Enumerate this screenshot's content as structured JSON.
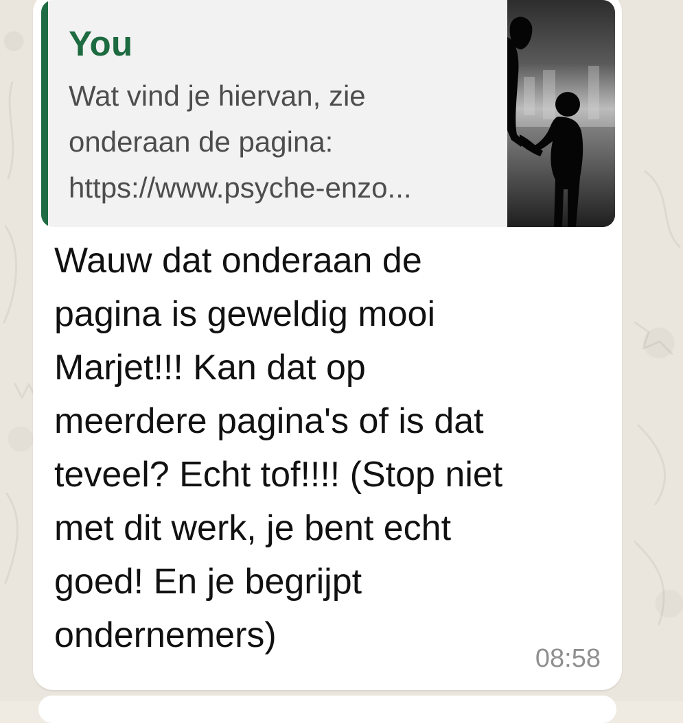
{
  "message": {
    "quoted": {
      "author": "You",
      "text": "Wat vind je hiervan, zie\nonderaan de pagina:\nhttps://www.psyche-enzo..."
    },
    "body": "Wauw dat onderaan de\npagina is geweldig mooi\nMarjet!!! Kan dat op\nmeerdere pagina's of is dat\nteveel? Echt tof!!!! (Stop niet\nmet dit werk, je bent echt\ngoed! En je begrijpt\nondernemers)",
    "time": "08:58"
  },
  "colors": {
    "quote_accent": "#1f6b43",
    "chat_background": "#ebe6dd",
    "bubble_background": "#ffffff"
  }
}
